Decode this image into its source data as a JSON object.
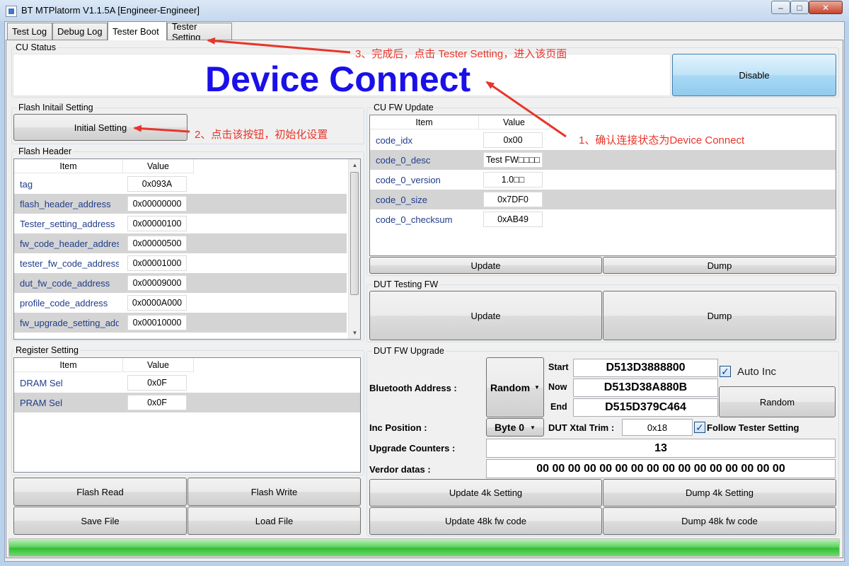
{
  "window": {
    "title": "BT MTPlatorm V1.1.5A [Engineer-Engineer]",
    "min_glyph": "–",
    "max_glyph": "□",
    "close_glyph": "✕"
  },
  "tabs": [
    {
      "label": "Test Log"
    },
    {
      "label": "Debug Log"
    },
    {
      "label": "Tester Boot"
    },
    {
      "label": "Tester Setting"
    }
  ],
  "active_tab": "Tester Boot",
  "cu_status": {
    "group_label": "CU Status",
    "status_text": "Device Connect",
    "status_color": "#1a10e8",
    "disable_label": "Disable"
  },
  "flash_initial": {
    "group_label": "Flash Initail Setting",
    "button_label": "Initial Setting"
  },
  "flash_header": {
    "group_label": "Flash Header",
    "col_item": "Item",
    "col_value": "Value",
    "rows": [
      {
        "item": "tag",
        "value": "0x093A"
      },
      {
        "item": "flash_header_address",
        "value": "0x00000000"
      },
      {
        "item": "Tester_setting_address",
        "value": "0x00000100"
      },
      {
        "item": "fw_code_header_address",
        "value": "0x00000500"
      },
      {
        "item": "tester_fw_code_address",
        "value": "0x00001000"
      },
      {
        "item": "dut_fw_code_address",
        "value": "0x00009000"
      },
      {
        "item": "profile_code_address",
        "value": "0x0000A000"
      },
      {
        "item": "fw_upgrade_setting_address",
        "value": "0x00010000"
      }
    ]
  },
  "register_setting": {
    "group_label": "Register Setting",
    "col_item": "Item",
    "col_value": "Value",
    "rows": [
      {
        "item": "DRAM Sel",
        "value": "0x0F"
      },
      {
        "item": "PRAM Sel",
        "value": "0x0F"
      }
    ]
  },
  "bottom_left_buttons": {
    "flash_read": "Flash Read",
    "flash_write": "Flash Write",
    "save_file": "Save File",
    "load_file": "Load File"
  },
  "cu_fw_update": {
    "group_label": "CU FW Update",
    "col_item": "Item",
    "col_value": "Value",
    "rows": [
      {
        "item": "code_idx",
        "value": "0x00"
      },
      {
        "item": "code_0_desc",
        "value": "Test FW□□□□"
      },
      {
        "item": "code_0_version",
        "value": "1.0□□"
      },
      {
        "item": "code_0_size",
        "value": "0x7DF0"
      },
      {
        "item": "code_0_checksum",
        "value": "0xAB49"
      }
    ],
    "update_label": "Update",
    "dump_label": "Dump"
  },
  "dut_testing_fw": {
    "group_label": "DUT Testing FW",
    "update_label": "Update",
    "dump_label": "Dump"
  },
  "dut_fw_upgrade": {
    "group_label": "DUT FW Upgrade",
    "bt_address_label": "Bluetooth Address :",
    "random_select": "Random",
    "start_label": "Start",
    "start_value": "D513D3888800",
    "now_label": "Now",
    "now_value": "D513D38A880B",
    "end_label": "End",
    "end_value": "D515D379C464",
    "auto_inc_label": "Auto Inc",
    "random_button": "Random",
    "inc_position_label": "Inc Position :",
    "inc_position_value": "Byte 0",
    "xtal_trim_label": "DUT Xtal Trim :",
    "xtal_trim_value": "0x18",
    "follow_label": "Follow Tester Setting",
    "upgrade_counters_label": "Upgrade Counters :",
    "upgrade_counters_value": "13",
    "vendor_datas_label": "Verdor datas :",
    "vendor_datas_value": "00 00 00 00 00 00 00 00 00 00 00 00 00 00 00 00",
    "update_4k": "Update 4k Setting",
    "dump_4k": "Dump 4k Setting",
    "update_48k": "Update 48k fw code",
    "dump_48k": "Dump 48k fw code"
  },
  "progress": {
    "value": 1.0,
    "color": "#5ed45e"
  },
  "annotations": {
    "step1": "1、确认连接状态为Device Connect",
    "step2": "2、点击该按钮，初始化设置",
    "step3": "3、完成后，点击 Tester Setting，进入该页面",
    "color": "#e8352a"
  }
}
